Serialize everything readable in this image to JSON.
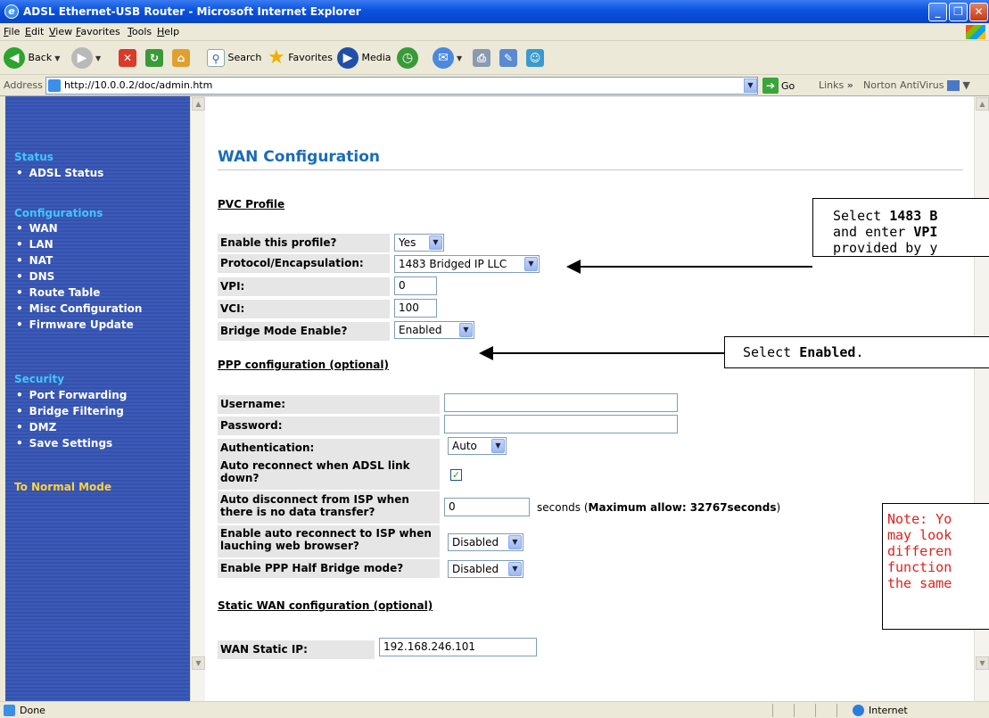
{
  "window": {
    "title": "ADSL Ethernet-USB Router - Microsoft Internet Explorer",
    "minimize": "_",
    "maximize": "❐",
    "close": "✕"
  },
  "menu": [
    "File",
    "Edit",
    "View",
    "Favorites",
    "Tools",
    "Help"
  ],
  "toolbar": {
    "back": "Back",
    "search": "Search",
    "favorites": "Favorites",
    "media": "Media"
  },
  "address": {
    "label": "Address",
    "url": "http://10.0.0.2/doc/admin.htm",
    "go": "Go",
    "links": "Links",
    "chevron": "»",
    "norton": "Norton AntiVirus"
  },
  "sidebar": {
    "status_heading": "Status",
    "status_items": [
      "ADSL Status"
    ],
    "config_heading": "Configurations",
    "config_items": [
      "WAN",
      "LAN",
      "NAT",
      "DNS",
      "Route Table",
      "Misc Configuration",
      "Firmware Update"
    ],
    "security_heading": "Security",
    "security_items": [
      "Port Forwarding",
      "Bridge Filtering",
      "DMZ",
      "Save Settings"
    ],
    "normal_mode": "To Normal Mode"
  },
  "page": {
    "title": "WAN Configuration",
    "pvc_heading": "PVC Profile",
    "enable_profile_label": "Enable this profile?",
    "enable_profile_value": "Yes",
    "protocol_label": "Protocol/Encapsulation:",
    "protocol_value": "1483 Bridged IP LLC",
    "vpi_label": "VPI:",
    "vpi_value": "0",
    "vci_label": "VCI:",
    "vci_value": "100",
    "bridge_label": "Bridge Mode Enable?",
    "bridge_value": "Enabled",
    "ppp_heading": "PPP configuration (optional)",
    "username_label": "Username:",
    "username_value": "",
    "password_label": "Password:",
    "password_value": "",
    "auth_label": "Authentication:",
    "auth_value": "Auto",
    "auto_reconnect_label": "Auto reconnect when ADSL link down?",
    "auto_disconnect_label": "Auto disconnect from ISP when there is no data transfer?",
    "auto_disconnect_value": "0",
    "seconds_prefix": "seconds (",
    "seconds_bold": "Maximum allow: 32767seconds",
    "seconds_suffix": ")",
    "auto_reconnect_browser_label": "Enable auto reconnect to ISP when lauching web browser?",
    "auto_reconnect_browser_value": "Disabled",
    "ppp_half_bridge_label": "Enable PPP Half Bridge mode?",
    "ppp_half_bridge_value": "Disabled",
    "static_heading": "Static WAN configuration (optional)",
    "wan_static_ip_label": "WAN Static IP:",
    "wan_static_ip_value": "192.168.246.101"
  },
  "callouts": {
    "c1_line1_a": "Select ",
    "c1_line1_b": "1483 B",
    "c1_line2_a": "and enter ",
    "c1_line2_b": "VPI",
    "c1_line3": "provided by y",
    "c2_a": "Select ",
    "c2_b": "Enabled",
    "c2_c": ".",
    "note_lines": [
      "Note: Yo",
      "may look",
      "differen",
      "function",
      "the same"
    ]
  },
  "status": {
    "text": "Done",
    "zone": "Internet"
  },
  "colors": {
    "sidebar_bg": "#3452ad",
    "sidebar_heading": "#41c6ff",
    "normal_mode": "#ffd23a",
    "title_blue": "#1a6cb8",
    "note_red": "#e0201c"
  }
}
